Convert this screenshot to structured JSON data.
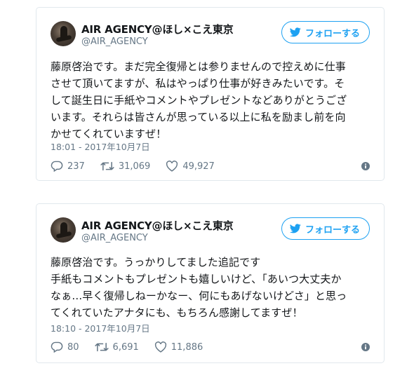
{
  "colors": {
    "accent": "#1da1f2",
    "muted": "#657786",
    "border": "#e1e8ed",
    "text": "#14171a"
  },
  "tweets": [
    {
      "name": "AIR AGENCY@ほし×こえ東京",
      "handle": "@AIR_AGENCY",
      "follow_label": "フォローする",
      "text": "藤原啓治です。まだ完全復帰とは参りませんので控えめに仕事\nさせて頂いてますが、私はやっぱり仕事が好きみたいです。そ\nして誕生日に手紙やコメントやプレゼントなどありがとうござ\nいます。それらは皆さんが思っている以上に私を励まし前を向\nかせてくれていますぜ！",
      "date": "18:01 - 2017年10月7日",
      "replies": "237",
      "retweets": "31,069",
      "likes": "49,927"
    },
    {
      "name": "AIR AGENCY@ほし×こえ東京",
      "handle": "@AIR_AGENCY",
      "follow_label": "フォローする",
      "text": "藤原啓治です。うっかりしてました追記です\n手紙もコメントもプレゼントも嬉しいけど、「あいつ大丈夫か\nなぁ…早く復帰しねーかなー、何にもあげないけどさ」と思っ\nてくれていたアナタにも、もちろん感謝してますぜ！",
      "date": "18:10 - 2017年10月7日",
      "replies": "80",
      "retweets": "6,691",
      "likes": "11,886"
    }
  ],
  "icons": {
    "bird": "twitter-bird-icon",
    "reply": "reply-icon",
    "retweet": "retweet-icon",
    "like": "heart-icon",
    "info": "info-icon"
  }
}
